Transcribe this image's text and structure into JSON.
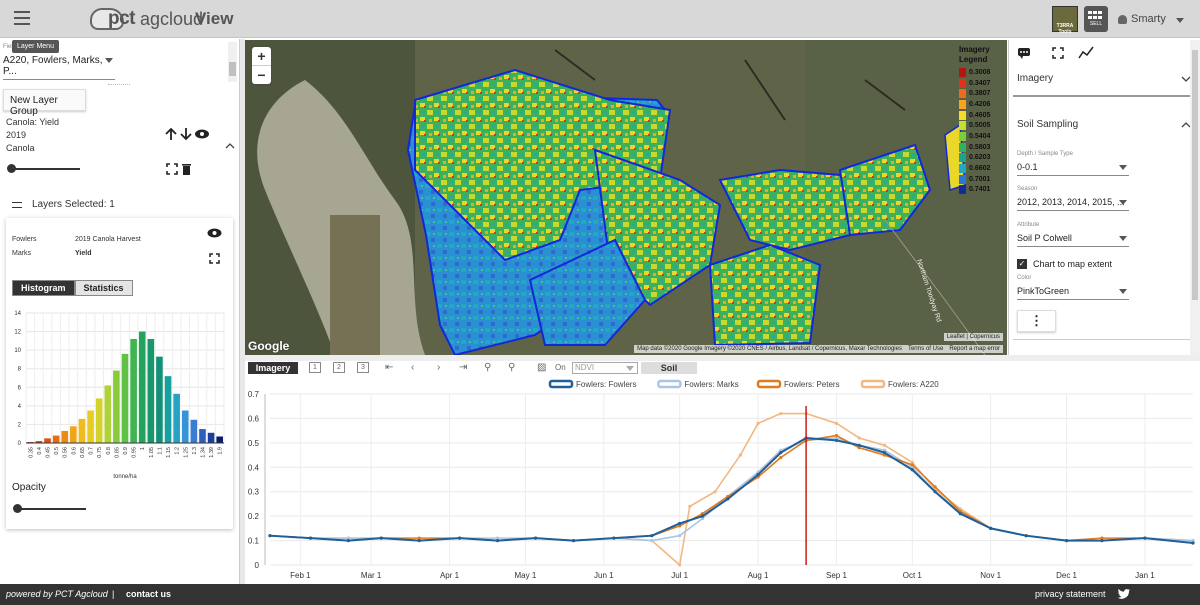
{
  "header": {
    "logo_pct": "pct",
    "logo_ag": "agcloud",
    "view_label": "View",
    "tools_label": "T3RRA Tools",
    "grid_label": "SELL",
    "user_name": "Smarty"
  },
  "left": {
    "tooltip": "Layer Menu",
    "field_label": "Field",
    "field_value": "A220, Fowlers, Marks, P...",
    "new_layer_group": "New Layer Group",
    "layer_name": "Canola: Yield",
    "layer_year": "2019",
    "layer_crop": "Canola",
    "layers_selected": "Layers Selected: 1",
    "card": {
      "farm": "Fowlers",
      "dataset": "2019 Canola Harvest",
      "field": "Marks",
      "attribute": "Yield",
      "tab_histogram": "Histogram",
      "tab_statistics": "Statistics",
      "x_unit": "tonne/ha"
    },
    "opacity_label": "Opacity"
  },
  "histogram": {
    "y_ticks": [
      0,
      2,
      4,
      6,
      8,
      10,
      12,
      14
    ],
    "bins": [
      "0.35",
      "0.4",
      "0.45",
      "0.5",
      "0.56",
      "0.6",
      "0.65",
      "0.7",
      "0.75",
      "0.8",
      "0.85",
      "0.9",
      "0.95",
      "1",
      "1.05",
      "1.1",
      "1.15",
      "1.2",
      "1.25",
      "1.3",
      "1.34",
      "1.39",
      "1.9"
    ],
    "values": [
      0.1,
      0.2,
      0.5,
      0.8,
      1.3,
      1.8,
      2.6,
      3.5,
      4.8,
      6.2,
      7.8,
      9.6,
      11.2,
      12.0,
      11.2,
      9.3,
      7.2,
      5.3,
      3.5,
      2.5,
      1.5,
      1.1,
      0.7
    ],
    "colors": [
      "#b1261c",
      "#c83a16",
      "#d85214",
      "#e46d14",
      "#ec8a16",
      "#f0a41a",
      "#efbb1e",
      "#e8cc22",
      "#d2d22a",
      "#aed23a",
      "#88cc3c",
      "#5fc245",
      "#3fb450",
      "#22a45e",
      "#17976c",
      "#139178",
      "#17a0a0",
      "#27a2c5",
      "#3793d7",
      "#3b7cd3",
      "#2f5fbc",
      "#1b3f9c",
      "#0c1c6d"
    ]
  },
  "map": {
    "legend_title": "Imagery Legend",
    "legend": [
      {
        "v": "0.3008",
        "c": "#b51511"
      },
      {
        "v": "0.3407",
        "c": "#e2311c"
      },
      {
        "v": "0.3807",
        "c": "#f06a1c"
      },
      {
        "v": "0.4206",
        "c": "#f8a51d"
      },
      {
        "v": "0.4605",
        "c": "#f7dc27"
      },
      {
        "v": "0.5005",
        "c": "#c6de2e"
      },
      {
        "v": "0.5404",
        "c": "#79cd3e"
      },
      {
        "v": "0.5803",
        "c": "#2fb25d"
      },
      {
        "v": "0.6203",
        "c": "#19a58a"
      },
      {
        "v": "0.6602",
        "c": "#20a8c2"
      },
      {
        "v": "0.7001",
        "c": "#2c77d0"
      },
      {
        "v": "0.7401",
        "c": "#142c9b"
      }
    ],
    "attribution": "Map data ©2020 Google Imagery ©2020 CNES / Airbus, Landsat / Copernicus, Maxar Technologies",
    "terms": "Terms of Use",
    "report": "Report a map error",
    "leaflet": "Leaflet | Copernicus",
    "google": "Google",
    "road": "Northam Toodyay Rd"
  },
  "right": {
    "imagery": "Imagery",
    "soil_sampling": "Soil Sampling",
    "depth_label": "Depth / Sample Type",
    "depth_value": "0-0.1",
    "season_label": "Season",
    "season_value": "2012, 2013, 2014, 2015, ...",
    "attribute_label": "Attribute",
    "attribute_value": "Soil P Colwell",
    "chart_extent": "Chart to map extent",
    "color_label": "Color",
    "color_value": "PinkToGreen",
    "more": "⋮"
  },
  "toolbar": {
    "imagery": "Imagery",
    "btn1": "1",
    "btn2": "2",
    "btn3": "3",
    "on_label": "On",
    "ndvi": "NDVI",
    "soil": "Soil"
  },
  "chart_data": {
    "type": "line",
    "title": "",
    "xlabel": "",
    "ylabel": "",
    "x_ticks": [
      "Feb 1",
      "Mar 1",
      "Apr 1",
      "May 1",
      "Jun 1",
      "Jul 1",
      "Aug 1",
      "Sep 1",
      "Oct 1",
      "Nov 1",
      "Dec 1",
      "Jan 1"
    ],
    "ylim": [
      0,
      0.7
    ],
    "y_ticks": [
      0,
      0.1,
      0.2,
      0.3,
      0.4,
      0.5,
      0.6,
      0.7
    ],
    "marker_date": "Aug 20",
    "series": [
      {
        "name": "Fowlers: Fowlers",
        "color": "#1f5f9a",
        "x": [
          "Jan 20",
          "Feb 5",
          "Feb 20",
          "Mar 5",
          "Mar 20",
          "Apr 5",
          "Apr 20",
          "May 5",
          "May 20",
          "Jun 5",
          "Jun 20",
          "Jul 1",
          "Jul 10",
          "Jul 20",
          "Aug 1",
          "Aug 10",
          "Aug 20",
          "Sep 1",
          "Sep 10",
          "Sep 20",
          "Oct 1",
          "Oct 10",
          "Oct 20",
          "Nov 1",
          "Nov 15",
          "Dec 1",
          "Dec 15",
          "Jan 1",
          "Jan 20"
        ],
        "values": [
          0.12,
          0.11,
          0.1,
          0.11,
          0.1,
          0.11,
          0.1,
          0.11,
          0.1,
          0.11,
          0.12,
          0.17,
          0.2,
          0.27,
          0.37,
          0.46,
          0.52,
          0.51,
          0.49,
          0.46,
          0.39,
          0.3,
          0.21,
          0.15,
          0.12,
          0.1,
          0.1,
          0.11,
          0.09
        ]
      },
      {
        "name": "Fowlers: Marks",
        "color": "#a9c6e4",
        "x": [
          "Jan 20",
          "Feb 5",
          "Feb 20",
          "Mar 5",
          "Mar 20",
          "Apr 5",
          "Apr 20",
          "May 5",
          "May 20",
          "Jun 5",
          "Jun 20",
          "Jul 1",
          "Jul 10",
          "Jul 20",
          "Aug 1",
          "Aug 10",
          "Aug 20",
          "Sep 1",
          "Sep 10",
          "Sep 20",
          "Oct 1",
          "Oct 10",
          "Oct 20",
          "Nov 1",
          "Nov 15",
          "Dec 1",
          "Dec 15",
          "Jan 1",
          "Jan 20"
        ],
        "values": [
          0.12,
          0.11,
          0.11,
          0.11,
          0.1,
          0.11,
          0.11,
          0.11,
          0.1,
          0.11,
          0.1,
          0.12,
          0.19,
          0.28,
          0.38,
          0.47,
          0.51,
          0.52,
          0.49,
          0.47,
          0.4,
          0.3,
          0.22,
          0.15,
          0.12,
          0.1,
          0.1,
          0.11,
          0.1
        ]
      },
      {
        "name": "Fowlers: Peters",
        "color": "#e07a1f",
        "x": [
          "Jan 20",
          "Feb 5",
          "Feb 20",
          "Mar 5",
          "Mar 20",
          "Apr 5",
          "Apr 20",
          "May 5",
          "May 20",
          "Jun 5",
          "Jun 20",
          "Jul 1",
          "Jul 10",
          "Jul 20",
          "Aug 1",
          "Aug 10",
          "Aug 20",
          "Sep 1",
          "Sep 10",
          "Sep 20",
          "Oct 1",
          "Oct 10",
          "Oct 20",
          "Nov 1",
          "Nov 15",
          "Dec 1",
          "Dec 15",
          "Jan 1",
          "Jan 20"
        ],
        "values": [
          0.12,
          0.11,
          0.1,
          0.11,
          0.11,
          0.11,
          0.1,
          0.11,
          0.1,
          0.11,
          0.12,
          0.16,
          0.21,
          0.28,
          0.36,
          0.44,
          0.51,
          0.53,
          0.48,
          0.45,
          0.41,
          0.32,
          0.22,
          0.15,
          0.12,
          0.1,
          0.11,
          0.11,
          0.09
        ]
      },
      {
        "name": "Fowlers: A220",
        "color": "#f2b882",
        "x": [
          "Jan 20",
          "Feb 5",
          "Feb 20",
          "Mar 5",
          "Mar 20",
          "Apr 5",
          "Apr 20",
          "May 5",
          "May 20",
          "Jun 5",
          "Jun 20",
          "Jul 1",
          "Jul 5",
          "Jul 15",
          "Jul 25",
          "Aug 1",
          "Aug 10",
          "Aug 20",
          "Sep 1",
          "Sep 10",
          "Sep 20",
          "Oct 1",
          "Oct 10",
          "Oct 20",
          "Nov 1",
          "Nov 15",
          "Dec 1",
          "Dec 15",
          "Jan 1",
          "Jan 20"
        ],
        "values": [
          0.12,
          0.11,
          0.11,
          0.11,
          0.1,
          0.11,
          0.1,
          0.11,
          0.1,
          0.11,
          0.1,
          0.0,
          0.24,
          0.3,
          0.45,
          0.58,
          0.62,
          0.62,
          0.58,
          0.52,
          0.49,
          0.42,
          0.31,
          0.23,
          0.15,
          0.12,
          0.1,
          0.1,
          0.11,
          0.1
        ]
      }
    ]
  }
}
